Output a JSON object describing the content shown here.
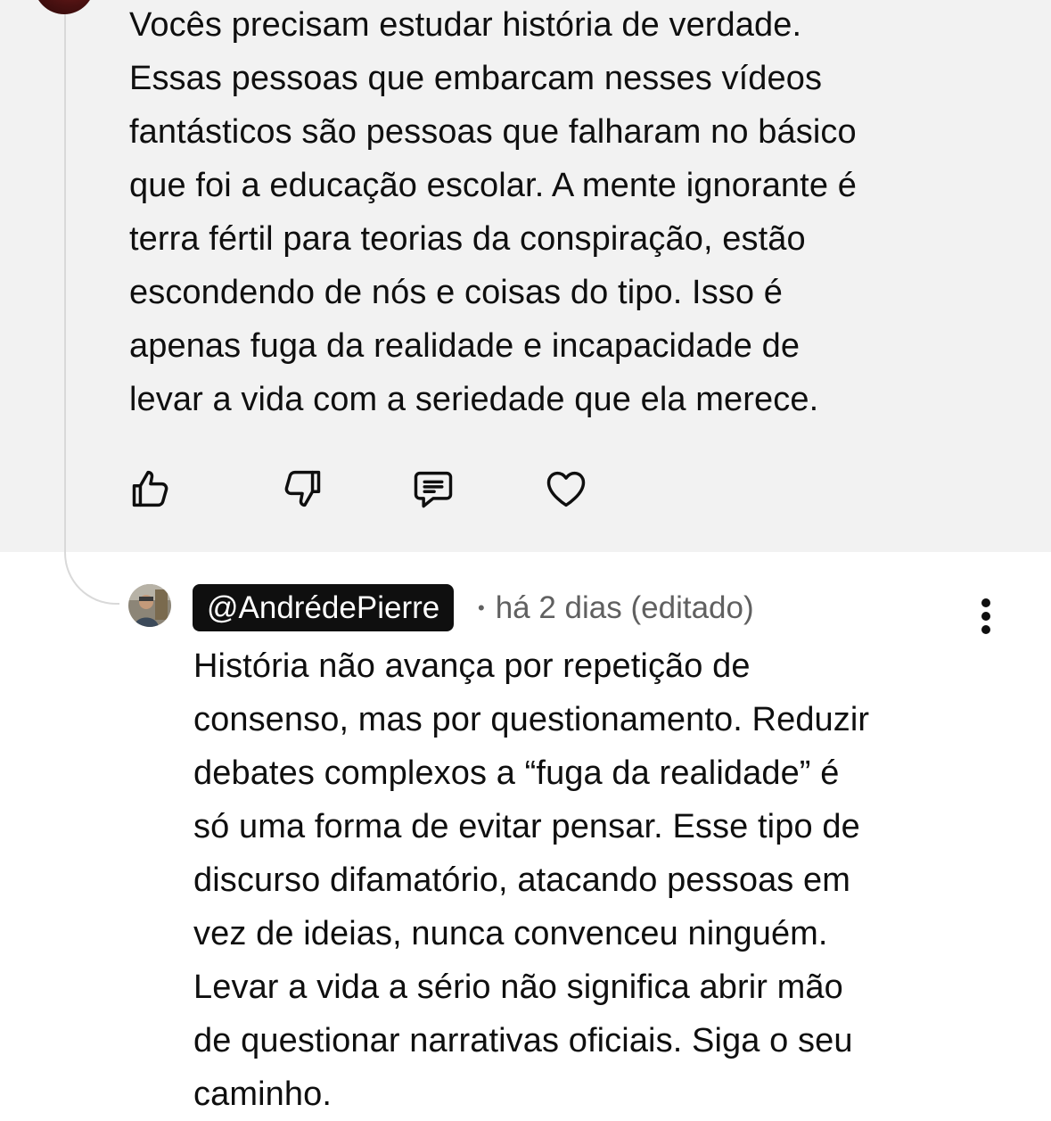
{
  "parent_comment": {
    "text_lines": [
      "Vocês precisam estudar história de verdade.",
      "Essas pessoas que embarcam nesses vídeos",
      "fantásticos são pessoas que falharam no básico",
      "que foi a educação escolar. A mente ignorante é",
      "terra fértil para teorias da conspiração, estão",
      "escondendo de nós e coisas do tipo. Isso é",
      "apenas fuga da realidade e incapacidade de",
      "levar a vida com a seriedade que ela merece."
    ],
    "actions": {
      "like_icon": "thumbs-up-icon",
      "dislike_icon": "thumbs-down-icon",
      "reply_icon": "comment-icon",
      "heart_icon": "heart-icon"
    },
    "highlight_color": "#f2f2f2"
  },
  "reply": {
    "author": "@AndrédePierre",
    "separator": "•",
    "timestamp": "há 2 dias (editado)",
    "menu_icon": "more-vertical-icon",
    "text_lines": [
      "História não avança por repetição de",
      "consenso, mas por questionamento. Reduzir",
      "debates complexos a “fuga da realidade” é",
      "só uma forma de evitar pensar. Esse tipo de",
      "discurso difamatório, atacando pessoas em",
      "vez de ideias, nunca convenceu ninguém.",
      "Levar a vida a sério não significa abrir mão",
      "de questionar narrativas oficiais. Siga o seu",
      "caminho."
    ]
  }
}
